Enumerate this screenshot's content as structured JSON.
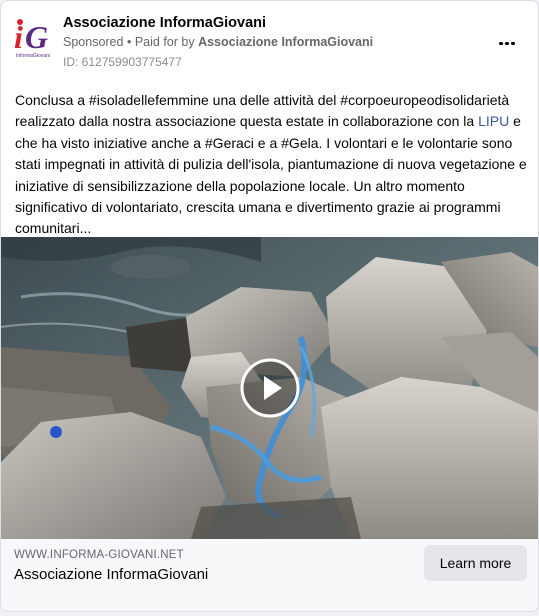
{
  "advertiser": {
    "name": "Associazione InformaGiovani",
    "logo_text": "iG",
    "logo_caption": "InformaGiovani"
  },
  "sponsorship": {
    "sponsored_label": "Sponsored",
    "separator": "•",
    "paid_for_prefix": "Paid for by",
    "payer_name": "Associazione InformaGiovani"
  },
  "ad_id": "ID: 612759903775477",
  "more_icon": "more-horizontal-icon",
  "post": {
    "text_part1": "Conclusa a #isoladellefemmine una delle attività del #corpoeuropeodisolidarietà realizzato dalla nostra associazione questa estate in collaborazione con la ",
    "link_text": "LIPU",
    "text_part2": " e che ha visto iniziative anche a #Geraci e a #Gela. I volontari e le volontarie sono stati impegnati in attività di pulizia dell'isola, piantumazione di nuova vegetazione e iniziative di sensibilizzazione della popolazione locale. Un altro momento significativo di volontariato, crescita umana e divertimento grazie ai programmi comunitari..."
  },
  "media": {
    "type": "video",
    "play_icon": "play-icon"
  },
  "footer": {
    "domain": "WWW.INFORMA-GIOVANI.NET",
    "title": "Associazione InformaGiovani",
    "cta_label": "Learn more"
  },
  "colors": {
    "text_primary": "#050505",
    "text_secondary": "#65676b",
    "link": "#385898",
    "logo_red": "#d8232a",
    "logo_purple": "#5b2a86",
    "cta_bg": "#e4e6eb"
  }
}
